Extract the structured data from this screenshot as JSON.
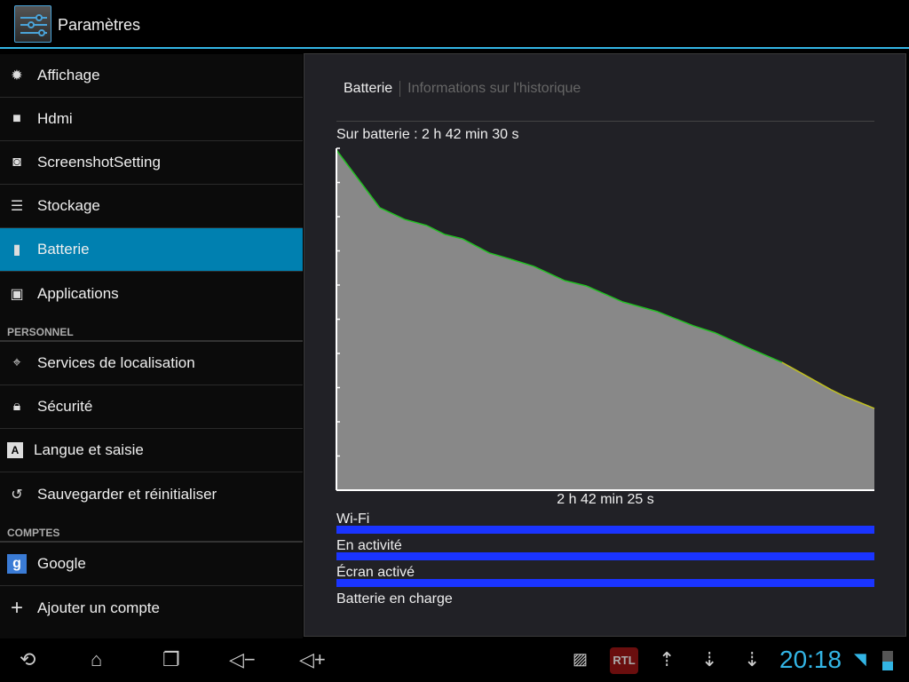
{
  "app": {
    "title": "Paramètres",
    "accent": "#33b5e5"
  },
  "sidebar": {
    "items": [
      {
        "label": "Affichage",
        "icon": "brightness-icon"
      },
      {
        "label": "Hdmi",
        "icon": "hdmi-icon"
      },
      {
        "label": "ScreenshotSetting",
        "icon": "camera-icon"
      },
      {
        "label": "Stockage",
        "icon": "storage-icon"
      },
      {
        "label": "Batterie",
        "icon": "battery-icon",
        "active": true
      },
      {
        "label": "Applications",
        "icon": "applications-icon"
      }
    ],
    "personnel_header": "PERSONNEL",
    "personnel": [
      {
        "label": "Services de localisation",
        "icon": "location-icon"
      },
      {
        "label": "Sécurité",
        "icon": "lock-icon"
      },
      {
        "label": "Langue et saisie",
        "icon": "keyboard-icon"
      },
      {
        "label": "Sauvegarder et réinitialiser",
        "icon": "backup-icon"
      }
    ],
    "comptes_header": "COMPTES",
    "comptes": [
      {
        "label": "Google",
        "icon": "google-icon"
      },
      {
        "label": "Ajouter un compte",
        "icon": "plus-icon"
      }
    ]
  },
  "panel": {
    "tabs": [
      "Batterie",
      "Informations sur l'historique"
    ],
    "on_battery": "Sur batterie : 2 h 42 min 30 s",
    "duration": "2 h 42 min 25 s",
    "timelines": [
      {
        "label": "Wi-Fi",
        "active_fraction": 1
      },
      {
        "label": "En activité",
        "active_fraction": 1
      },
      {
        "label": "Écran activé",
        "active_fraction": 1
      },
      {
        "label": "Batterie en charge",
        "active_fraction": 0
      }
    ],
    "timeline_color": "#1a34ff"
  },
  "chart_data": {
    "type": "area",
    "xlabel": "2 h 42 min 25 s",
    "x_unit": "minutes on battery",
    "xlim": [
      0,
      162.4
    ],
    "ylim": [
      0,
      100
    ],
    "y_unit": "battery %",
    "grid": false,
    "line_color": "#22c022",
    "low_line_color": "#c0c020",
    "fill_color": "#888888",
    "points": [
      [
        0,
        99.5
      ],
      [
        13.1,
        82.6
      ],
      [
        20.6,
        79.2
      ],
      [
        27.3,
        77.4
      ],
      [
        32.7,
        74.8
      ],
      [
        38.1,
        73.5
      ],
      [
        46.1,
        69.4
      ],
      [
        52.8,
        67.5
      ],
      [
        59.5,
        65.5
      ],
      [
        68.9,
        61.3
      ],
      [
        75.6,
        59.7
      ],
      [
        86.3,
        55.1
      ],
      [
        97.0,
        52.2
      ],
      [
        107.7,
        48.1
      ],
      [
        114.4,
        46.0
      ],
      [
        125.1,
        41.3
      ],
      [
        134.5,
        37.4
      ],
      [
        149.3,
        29.4
      ],
      [
        153.3,
        27.5
      ],
      [
        162.4,
        23.9
      ]
    ]
  },
  "statusbar": {
    "time": "20:18",
    "icons": [
      "gallery-icon",
      "rtl-app-icon",
      "upload-icon",
      "download-icon",
      "download-icon",
      "wifi-icon",
      "battery-status-icon"
    ]
  },
  "navbar": {
    "buttons": [
      "back",
      "home",
      "recent-apps",
      "volume-down",
      "volume-up"
    ]
  }
}
